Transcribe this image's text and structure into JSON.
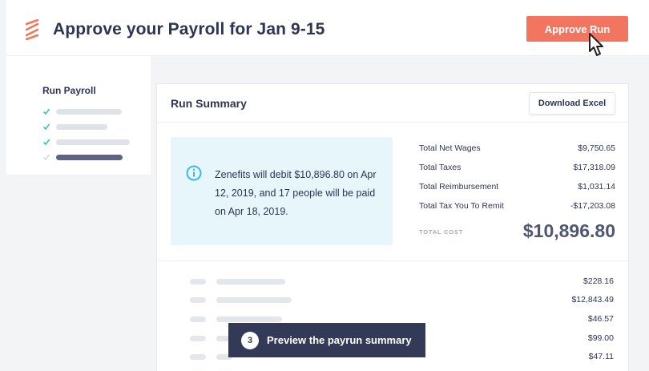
{
  "header": {
    "title": "Approve your Payroll for Jan 9-15",
    "approve_label": "Approve Run",
    "accent_color": "#f2765f"
  },
  "sidebar": {
    "title": "Run Payroll",
    "steps": [
      {
        "status": "complete"
      },
      {
        "status": "complete"
      },
      {
        "status": "complete"
      },
      {
        "status": "current"
      }
    ]
  },
  "summary": {
    "title": "Run Summary",
    "download_label": "Download Excel",
    "info_text": "Zenefits will debit $10,896.80 on Apr 12, 2019, and 17 people will be paid on Apr 18, 2019.",
    "totals": [
      {
        "label": "Total Net Wages",
        "value": "$9,750.65"
      },
      {
        "label": "Total Taxes",
        "value": "$17,318.09"
      },
      {
        "label": "Total Reimbursement",
        "value": "$1,031.14"
      },
      {
        "label": "Total Tax You To Remit",
        "value": "-$17,203.08"
      }
    ],
    "total_cost_label": "TOTAL COST",
    "total_cost_value": "$10,896.80"
  },
  "line_items": [
    "$228.16",
    "$12,843.49",
    "$46.57",
    "$99.00",
    "$47.11"
  ],
  "tooltip": {
    "step_number": "3",
    "text": "Preview the payrun summary"
  }
}
